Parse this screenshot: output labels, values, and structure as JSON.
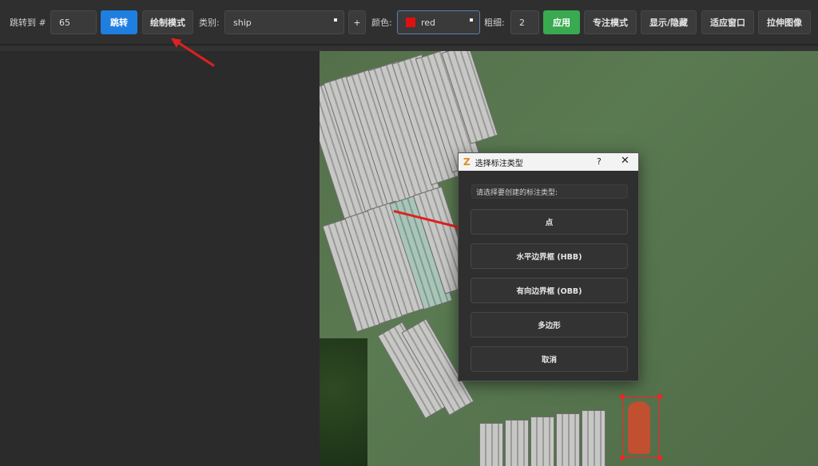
{
  "toolbar": {
    "jump_label": "跳转到 #",
    "jump_value": "65",
    "jump_button": "跳转",
    "draw_mode_button": "绘制模式",
    "category_label": "类别:",
    "category_value": "ship",
    "add_button": "+",
    "color_label": "颜色:",
    "color_value": "red",
    "color_swatch": "#e01010",
    "thickness_label": "粗细:",
    "thickness_value": "2",
    "apply_button": "应用",
    "focus_mode_button": "专注模式",
    "show_hide_button": "显示/隐藏",
    "fit_window_button": "适应窗口",
    "stretch_image_button": "拉伸图像"
  },
  "dialog": {
    "title": "选择标注类型",
    "help": "?",
    "close": "✕",
    "prompt": "请选择要创建的标注类型:",
    "options": [
      "点",
      "水平边界框 (HBB)",
      "有向边界框 (OBB)",
      "多边形",
      "取消"
    ]
  },
  "colors": {
    "primary_blue": "#1f7fe0",
    "apply_green": "#3aaa50",
    "annotation_red": "#ff2020"
  }
}
